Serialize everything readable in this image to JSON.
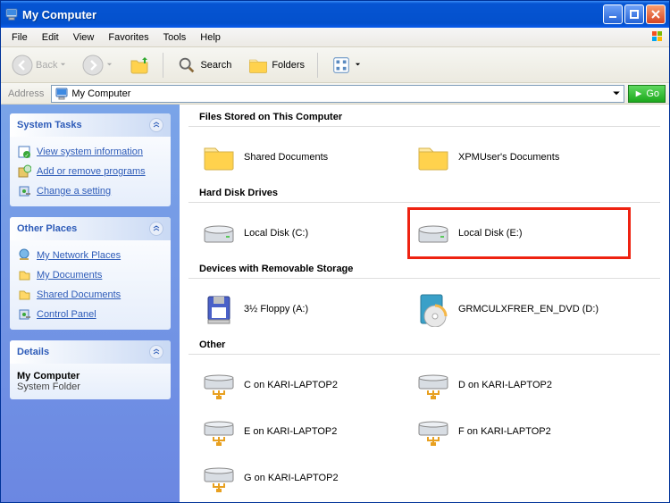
{
  "window": {
    "title": "My Computer"
  },
  "menubar": [
    "File",
    "Edit",
    "View",
    "Favorites",
    "Tools",
    "Help"
  ],
  "toolbar": {
    "back": "Back",
    "search": "Search",
    "folders": "Folders"
  },
  "addressbar": {
    "label": "Address",
    "value": "My Computer",
    "go": "Go"
  },
  "sidebar": {
    "systemTasks": {
      "title": "System Tasks",
      "links": [
        {
          "label": "View system information"
        },
        {
          "label": "Add or remove programs"
        },
        {
          "label": "Change a setting"
        }
      ]
    },
    "otherPlaces": {
      "title": "Other Places",
      "links": [
        {
          "label": "My Network Places"
        },
        {
          "label": "My Documents"
        },
        {
          "label": "Shared Documents"
        },
        {
          "label": "Control Panel"
        }
      ]
    },
    "details": {
      "title": "Details",
      "name": "My Computer",
      "type": "System Folder"
    }
  },
  "content": {
    "section1": {
      "title": "Files Stored on This Computer"
    },
    "section2": {
      "title": "Hard Disk Drives"
    },
    "section3": {
      "title": "Devices with Removable Storage"
    },
    "section4": {
      "title": "Other"
    },
    "items": {
      "shared_docs": "Shared Documents",
      "user_docs": "XPMUser's Documents",
      "disk_c": "Local Disk (C:)",
      "disk_e": "Local Disk (E:)",
      "floppy": "3½ Floppy (A:)",
      "dvd": "GRMCULXFRER_EN_DVD (D:)",
      "net_c": "C on KARI-LAPTOP2",
      "net_d": "D on KARI-LAPTOP2",
      "net_e": "E on KARI-LAPTOP2",
      "net_f": "F on KARI-LAPTOP2",
      "net_g": "G on KARI-LAPTOP2"
    }
  }
}
